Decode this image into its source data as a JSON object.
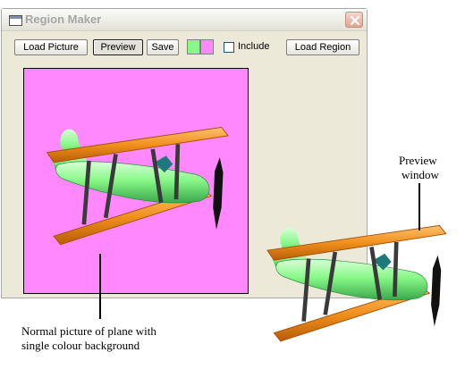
{
  "window": {
    "title": "Region Maker",
    "title_icon": "app-window-icon",
    "close_icon": "close-icon"
  },
  "toolbar": {
    "load_picture_label": "Load Picture",
    "preview_label": "Preview",
    "save_label": "Save",
    "include_label": "Include",
    "include_checked": false,
    "load_region_label": "Load Region",
    "swatch_colors": [
      "#88f888",
      "#ff88ff"
    ]
  },
  "preview": {
    "background_color": "#ff88ff"
  },
  "annotations": {
    "preview_line1": "Preview",
    "preview_line2": "window",
    "normal_line1": "Normal picture of plane with",
    "normal_line2": "single colour background"
  },
  "colors": {
    "plane_body": "#88f888",
    "plane_wings": "#f0901c",
    "struts": "#3a3a3a"
  }
}
